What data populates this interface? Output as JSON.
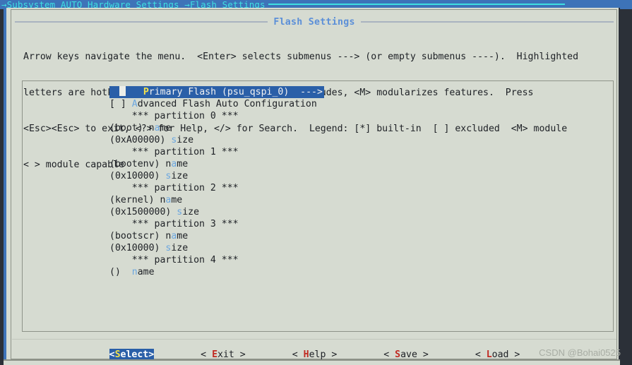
{
  "breadcrumb": {
    "text": "→Subsystem AUTO Hardware Settings →Flash Settings"
  },
  "window": {
    "title": "Flash Settings"
  },
  "help": {
    "line1": "Arrow keys navigate the menu.  <Enter> selects submenus ---> (or empty submenus ----).  Highlighted",
    "line2": "letters are hotkeys.  Pressing <Y> includes, <N> excludes, <M> modularizes features.  Press",
    "line3": "<Esc><Esc> to exit, <?> for Help, </> for Search.  Legend: [*] built-in  [ ] excluded  <M> module",
    "line4": "< > module capable"
  },
  "menu": {
    "items": [
      {
        "pre": "",
        "hot": "P",
        "post": "rimary Flash (psu_qspi_0)  --->",
        "selected": true
      },
      {
        "pre": "[ ] ",
        "hot": "A",
        "post": "dvanced Flash Auto Configuration",
        "selected": false
      },
      {
        "pre": "    *** partition 0 ***",
        "hot": "",
        "post": "",
        "selected": false
      },
      {
        "pre": "(boot) n",
        "hot": "a",
        "post": "me",
        "selected": false
      },
      {
        "pre": "(0xA00000) ",
        "hot": "s",
        "post": "ize",
        "selected": false
      },
      {
        "pre": "    *** partition 1 ***",
        "hot": "",
        "post": "",
        "selected": false
      },
      {
        "pre": "(bootenv) n",
        "hot": "a",
        "post": "me",
        "selected": false
      },
      {
        "pre": "(0x10000) ",
        "hot": "s",
        "post": "ize",
        "selected": false
      },
      {
        "pre": "    *** partition 2 ***",
        "hot": "",
        "post": "",
        "selected": false
      },
      {
        "pre": "(kernel) n",
        "hot": "a",
        "post": "me",
        "selected": false
      },
      {
        "pre": "(0x1500000) ",
        "hot": "s",
        "post": "ize",
        "selected": false
      },
      {
        "pre": "    *** partition 3 ***",
        "hot": "",
        "post": "",
        "selected": false
      },
      {
        "pre": "(bootscr) n",
        "hot": "a",
        "post": "me",
        "selected": false
      },
      {
        "pre": "(0x10000) ",
        "hot": "s",
        "post": "ize",
        "selected": false
      },
      {
        "pre": "    *** partition 4 ***",
        "hot": "",
        "post": "",
        "selected": false
      },
      {
        "pre": "()  ",
        "hot": "n",
        "post": "ame",
        "selected": false
      }
    ]
  },
  "buttons": [
    {
      "pre": "<",
      "hotkey": "S",
      "post": "elect>",
      "active": true,
      "name": "select"
    },
    {
      "pre": "< ",
      "hotkey": "E",
      "post": "xit >",
      "active": false,
      "name": "exit"
    },
    {
      "pre": "< ",
      "hotkey": "H",
      "post": "elp >",
      "active": false,
      "name": "help"
    },
    {
      "pre": "< ",
      "hotkey": "S",
      "post": "ave >",
      "active": false,
      "name": "save"
    },
    {
      "pre": "< ",
      "hotkey": "L",
      "post": "oad >",
      "active": false,
      "name": "load"
    }
  ],
  "watermark": {
    "text": "CSDN @Bohai0525"
  },
  "colors": {
    "titlebar_bg": "#3d73b8",
    "titlebar_fg": "#3fe0e0",
    "dialog_bg": "#d6dbd1",
    "selection_bg": "#2a5fa8",
    "hotkey_fg": "#6aa6e0",
    "button_hotkey_fg": "#c02a22",
    "active_hotkey_fg": "#f2e14c",
    "window_title_fg": "#5b8fd8"
  }
}
